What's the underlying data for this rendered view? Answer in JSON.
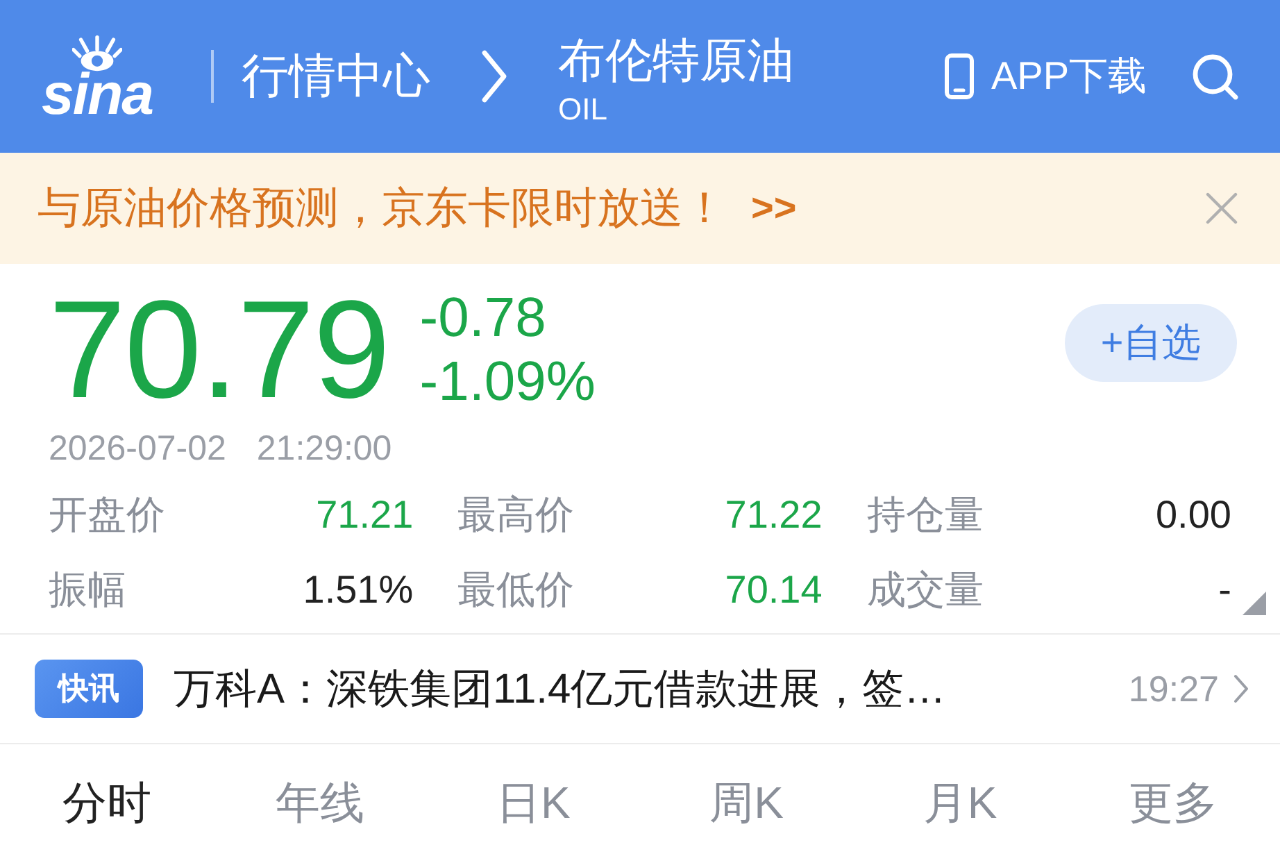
{
  "header": {
    "logo_text": "sina",
    "section": "行情中心",
    "title": "布伦特原油",
    "subtitle": "OIL",
    "app_download": "APP下载"
  },
  "banner": {
    "text": "与原油价格预测，京东卡限时放送！",
    "more": ">>"
  },
  "quote": {
    "price": "70.79",
    "change": "-0.78",
    "change_percent": "-1.09%",
    "falling": true,
    "watch_button": "+自选",
    "date": "2026-07-02",
    "time": "21:29:00"
  },
  "stats": [
    {
      "label": "开盘价",
      "value": "71.21",
      "color": "#1ba649"
    },
    {
      "label": "最高价",
      "value": "71.22",
      "color": "#1ba649"
    },
    {
      "label": "持仓量",
      "value": "0.00",
      "color": "#222222"
    },
    {
      "label": "振幅",
      "value": "1.51%",
      "color": "#222222"
    },
    {
      "label": "最低价",
      "value": "70.14",
      "color": "#1ba649"
    },
    {
      "label": "成交量",
      "value": "-",
      "color": "#222222"
    }
  ],
  "news": {
    "badge": "快讯",
    "headline": "万科A：深铁集团11.4亿元借款进展，签…",
    "time": "19:27"
  },
  "tabs": [
    {
      "label": "分时",
      "selected": true
    },
    {
      "label": "年线",
      "selected": false
    },
    {
      "label": "日K",
      "selected": false
    },
    {
      "label": "周K",
      "selected": false
    },
    {
      "label": "月K",
      "selected": false
    },
    {
      "label": "更多",
      "selected": false
    }
  ]
}
